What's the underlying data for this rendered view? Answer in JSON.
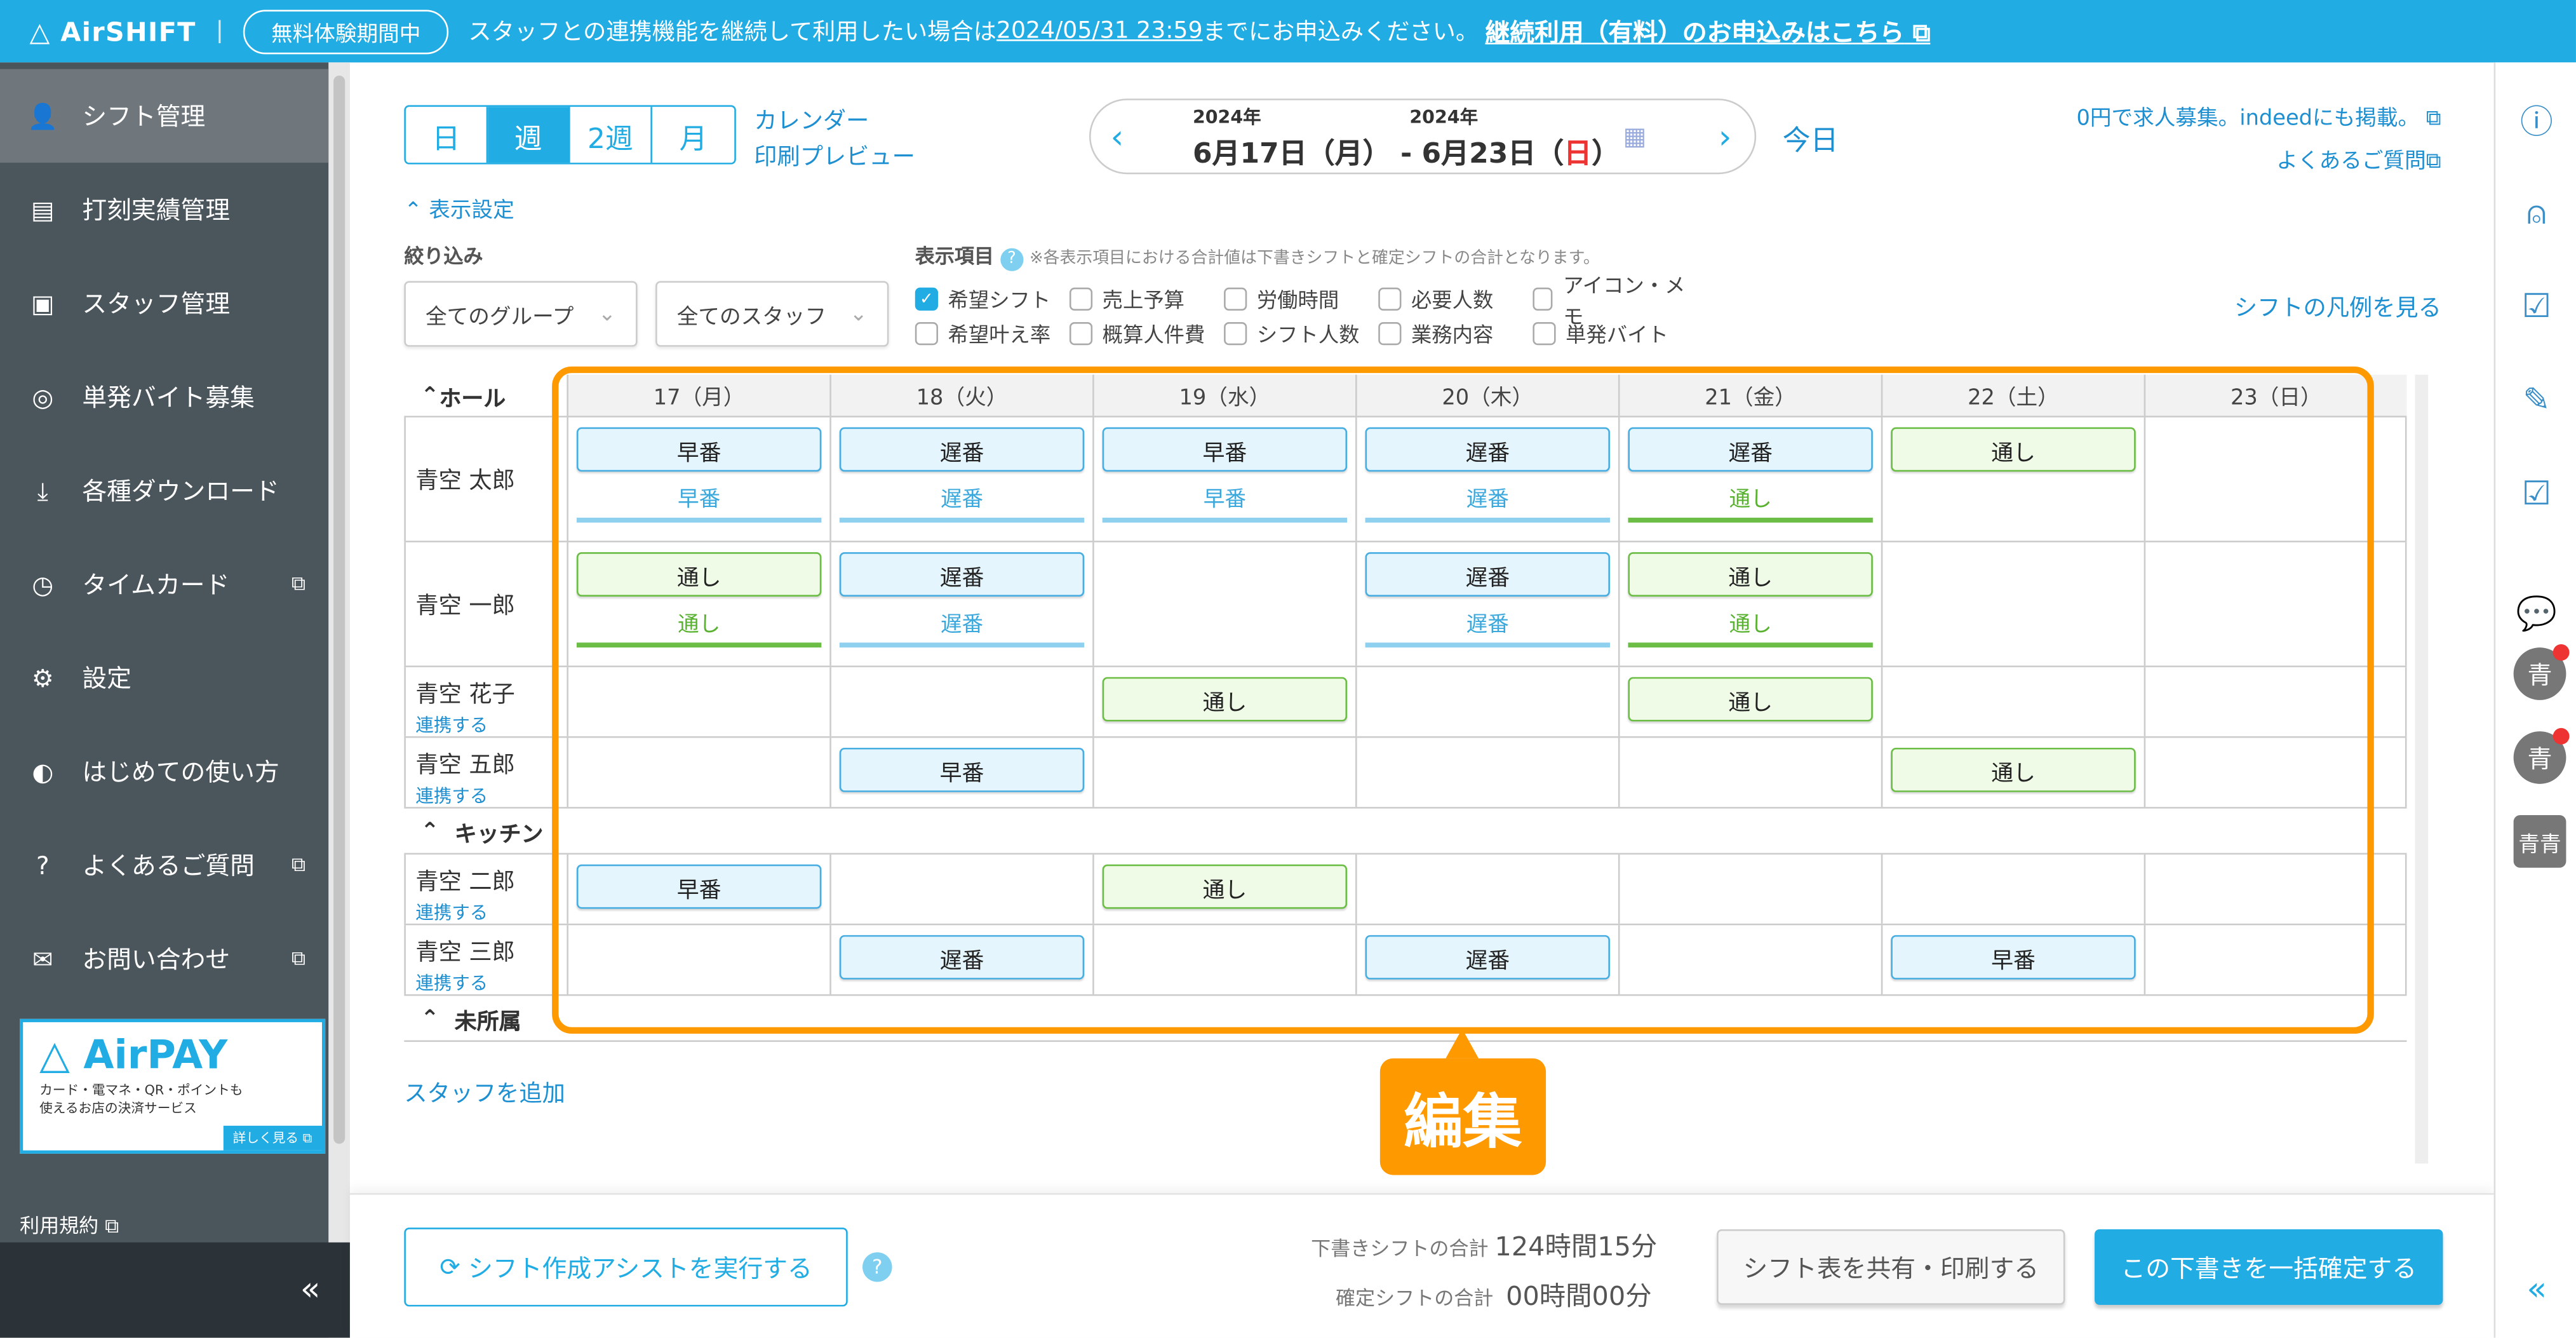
{
  "banner": {
    "logo": "AirSHIFT",
    "trial_badge": "無料体験期間中",
    "message_pre": "スタッフとの連携機能を継続して利用したい場合は",
    "deadline": "2024/05/31 23:59",
    "message_post": "までにお申込みください。",
    "cta": "継続利用（有料）のお申込みはこちら",
    "color": "#21ace3"
  },
  "sidebar": {
    "items": [
      {
        "label": "シフト管理",
        "icon": "shift-user-icon",
        "active": true
      },
      {
        "label": "打刻実績管理",
        "icon": "timesheet-icon"
      },
      {
        "label": "スタッフ管理",
        "icon": "staff-card-icon"
      },
      {
        "label": "単発バイト募集",
        "icon": "search-user-icon"
      },
      {
        "label": "各種ダウンロード",
        "icon": "download-icon"
      },
      {
        "label": "タイムカード",
        "icon": "timecard-icon",
        "external": true
      },
      {
        "label": "設定",
        "icon": "gear-icon"
      },
      {
        "label": "はじめての使い方",
        "icon": "guide-icon"
      },
      {
        "label": "よくあるご質問",
        "icon": "question-icon",
        "external": true
      },
      {
        "label": "お問い合わせ",
        "icon": "mail-icon",
        "external": true
      }
    ],
    "ad": {
      "logo": "AirPAY",
      "line1": "カード・電マネ・QR・ポイントも",
      "line2": "使えるお店の決済サービス",
      "more": "詳しく見る"
    },
    "terms": "利用規約",
    "collapse": "«"
  },
  "toolbar": {
    "views": [
      "日",
      "週",
      "2週",
      "月"
    ],
    "active_view": "週",
    "calendar_print_1": "カレンダー",
    "calendar_print_2": "印刷プレビュー",
    "start_year": "2024年",
    "end_year": "2024年",
    "start_date": "6月17日（月）",
    "separator": "-",
    "end_date_pre": "6月23日（",
    "end_date_day": "日",
    "end_date_post": "）",
    "today": "今日",
    "job_link": "0円で求人募集。indeedにも掲載。",
    "faq_link": "よくあるご質問"
  },
  "settings": {
    "toggle": "表示設定",
    "filter_label": "絞り込み",
    "group_select": "全てのグループ",
    "staff_select": "全てのスタッフ",
    "items_label": "表示項目",
    "note": "※各表示項目における合計値は下書きシフトと確定シフトの合計となります。",
    "checkboxes": [
      {
        "label": "希望シフト",
        "checked": true
      },
      {
        "label": "売上予算"
      },
      {
        "label": "労働時間"
      },
      {
        "label": "必要人数"
      },
      {
        "label": "アイコン・メモ"
      },
      {
        "label": "希望叶え率"
      },
      {
        "label": "概算人件費"
      },
      {
        "label": "シフト人数"
      },
      {
        "label": "業務内容"
      },
      {
        "label": "単発バイト"
      }
    ],
    "legend_link": "シフトの凡例を見る"
  },
  "grid": {
    "days": [
      "17（月）",
      "18（火）",
      "19（水）",
      "20（木）",
      "21（金）",
      "22（土）",
      "23（日）"
    ],
    "groups": [
      {
        "name": "ホール",
        "rows": [
          {
            "name": "青空 太郎",
            "cells": [
              {
                "shift": "早番",
                "c": "blue",
                "hope": "早番",
                "hc": "blue"
              },
              {
                "shift": "遅番",
                "c": "blue",
                "hope": "遅番",
                "hc": "blue"
              },
              {
                "shift": "早番",
                "c": "blue",
                "hope": "早番",
                "hc": "blue"
              },
              {
                "shift": "遅番",
                "c": "blue",
                "hope": "遅番",
                "hc": "blue"
              },
              {
                "shift": "遅番",
                "c": "blue",
                "hope": "通し",
                "hc": "green"
              },
              {
                "shift": "通し",
                "c": "green"
              },
              {}
            ]
          },
          {
            "name": "青空 一郎",
            "cells": [
              {
                "shift": "通し",
                "c": "green",
                "hope": "通し",
                "hc": "green"
              },
              {
                "shift": "遅番",
                "c": "blue",
                "hope": "遅番",
                "hc": "blue"
              },
              {},
              {
                "shift": "遅番",
                "c": "blue",
                "hope": "遅番",
                "hc": "blue"
              },
              {
                "shift": "通し",
                "c": "green",
                "hope": "通し",
                "hc": "green"
              },
              {},
              {}
            ]
          },
          {
            "name": "青空 花子",
            "link": "連携する",
            "cells": [
              {},
              {},
              {
                "shift": "通し",
                "c": "green"
              },
              {},
              {
                "shift": "通し",
                "c": "green"
              },
              {},
              {}
            ]
          },
          {
            "name": "青空 五郎",
            "link": "連携する",
            "cells": [
              {},
              {
                "shift": "早番",
                "c": "blue"
              },
              {},
              {},
              {},
              {
                "shift": "通し",
                "c": "green"
              },
              {}
            ]
          }
        ]
      },
      {
        "name": "キッチン",
        "rows": [
          {
            "name": "青空 二郎",
            "link": "連携する",
            "cells": [
              {
                "shift": "早番",
                "c": "blue"
              },
              {},
              {
                "shift": "通し",
                "c": "green"
              },
              {},
              {},
              {},
              {}
            ]
          },
          {
            "name": "青空 三郎",
            "link": "連携する",
            "cells": [
              {},
              {
                "shift": "遅番",
                "c": "blue"
              },
              {},
              {
                "shift": "遅番",
                "c": "blue"
              },
              {},
              {
                "shift": "早番",
                "c": "blue"
              },
              {}
            ]
          }
        ]
      },
      {
        "name": "未所属",
        "rows": []
      }
    ],
    "add_staff": "スタッフを追加"
  },
  "callout": {
    "label": "編集",
    "color": "#ff9900"
  },
  "footer": {
    "assist": "シフト作成アシストを実行する",
    "draft_label": "下書きシフトの合計",
    "draft_value": "124時間15分",
    "confirmed_label": "確定シフトの合計",
    "confirmed_value": "00時間00分",
    "share": "シフト表を共有・印刷する",
    "confirm": "この下書きを一括確定する"
  },
  "rail": {
    "icons": [
      "info-icon",
      "add-user-icon",
      "shift-check-icon",
      "shift-edit-icon",
      "staff-check-icon",
      "chat-icon"
    ],
    "avatars": [
      "青",
      "青",
      "青青"
    ],
    "collapse": "«"
  }
}
